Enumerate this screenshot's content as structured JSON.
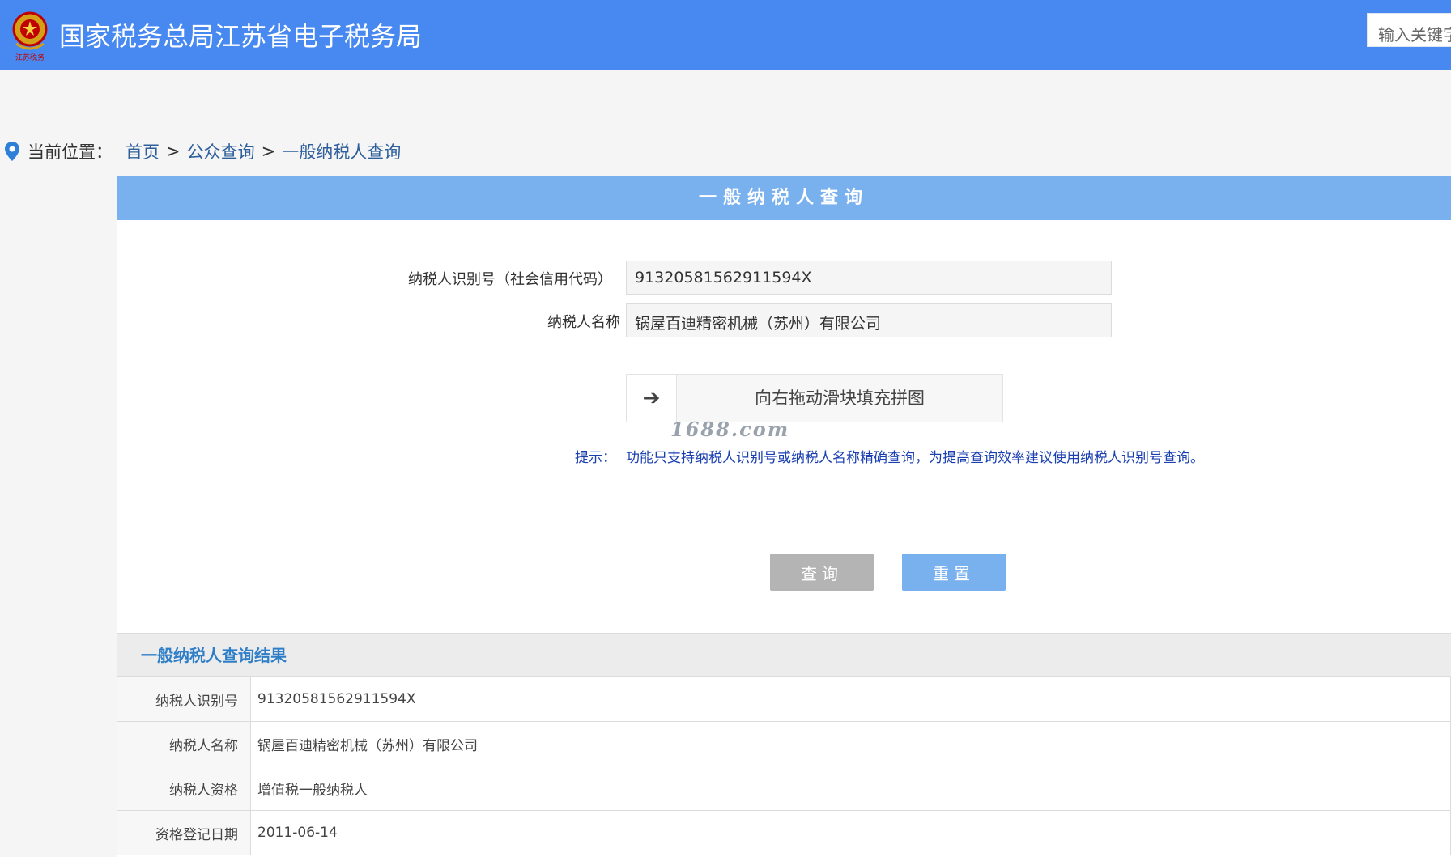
{
  "header": {
    "emblem_text": "江苏税务",
    "title": "国家税务总局江苏省电子税务局",
    "search_placeholder": "输入关键字"
  },
  "breadcrumb": {
    "label": "当前位置：",
    "items": [
      "首页",
      "公众查询",
      "一般纳税人查询"
    ],
    "separator": ">"
  },
  "panel": {
    "title": "一般纳税人查询"
  },
  "form": {
    "id_label": "纳税人识别号（社会信用代码）",
    "id_value": "91320581562911594X",
    "name_label": "纳税人名称",
    "name_value": "锅屋百迪精密机械（苏州）有限公司",
    "slider_text": "向右拖动滑块填充拼图",
    "hint_label": "提示：",
    "hint_text": "功能只支持纳税人识别号或纳税人名称精确查询，为提高查询效率建议使用纳税人识别号查询。",
    "query_button": "查询",
    "reset_button": "重置"
  },
  "watermark": "1688.com",
  "results": {
    "title": "一般纳税人查询结果",
    "rows": [
      {
        "key": "纳税人识别号",
        "value": "91320581562911594X"
      },
      {
        "key": "纳税人名称",
        "value": "锅屋百迪精密机械（苏州）有限公司"
      },
      {
        "key": "纳税人资格",
        "value": "增值税一般纳税人"
      },
      {
        "key": "资格登记日期",
        "value": "2011-06-14"
      }
    ]
  },
  "colors": {
    "header_bg": "#4789f1",
    "panel_title_bg": "#79b0ee",
    "result_title": "#2f7fc8",
    "hint_text": "#1a3fb0"
  }
}
